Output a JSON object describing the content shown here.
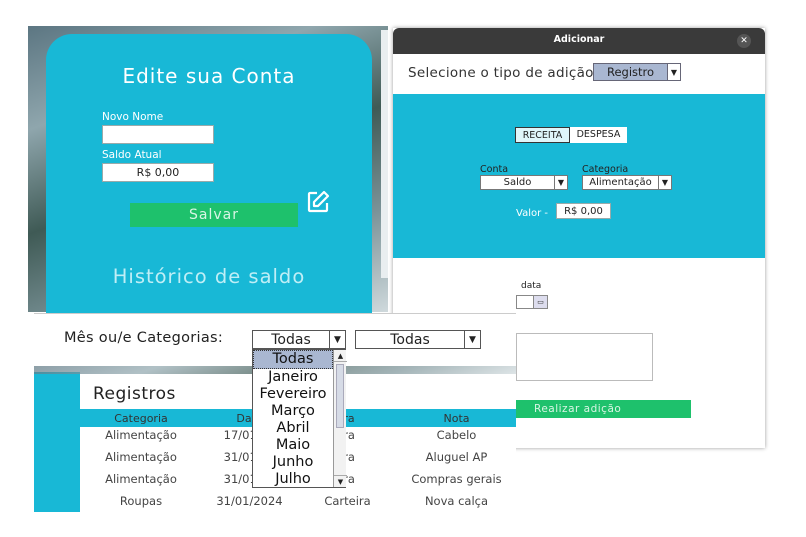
{
  "edit_account": {
    "title": "Edite sua Conta",
    "new_name_label": "Novo Nome",
    "new_name_value": "",
    "balance_label": "Saldo Atual",
    "balance_value": "R$ 0,00",
    "save_label": "Salvar",
    "history_title": "Histórico de saldo"
  },
  "add_dialog": {
    "title": "Adicionar",
    "type_label": "Selecione o tipo de adição:",
    "type_value": "Registro",
    "tabs": [
      "RECEITA",
      "DESPESA"
    ],
    "account_label": "Conta",
    "account_value": "Saldo",
    "category_label": "Categoria",
    "category_value": "Alimentação",
    "value_label": "Valor -",
    "value_value": "R$ 0,00",
    "date_label": "data",
    "submit_label": "Realizar adição"
  },
  "filter": {
    "label": "Mês ou/e Categorias:",
    "month_value": "Todas",
    "category_value": "Todas",
    "month_options": [
      "Todas",
      "Janeiro",
      "Fevereiro",
      "Março",
      "Abril",
      "Maio",
      "Junho",
      "Julho"
    ]
  },
  "records": {
    "title": "Registros",
    "columns": [
      "Categoria",
      "Data",
      "ira",
      "Nota"
    ],
    "rows": [
      [
        "Alimentação",
        "17/01/20",
        "ira",
        "Cabelo"
      ],
      [
        "Alimentação",
        "31/01/20",
        "ira",
        "Aluguel AP"
      ],
      [
        "Alimentação",
        "31/01/20",
        "ira",
        "Compras gerais"
      ],
      [
        "Roupas",
        "31/01/2024",
        "Carteira",
        "Nova calça"
      ]
    ]
  },
  "colors": {
    "teal": "#18b8d6",
    "green": "#1ec16c",
    "dialog_header": "#3a3a3a"
  }
}
